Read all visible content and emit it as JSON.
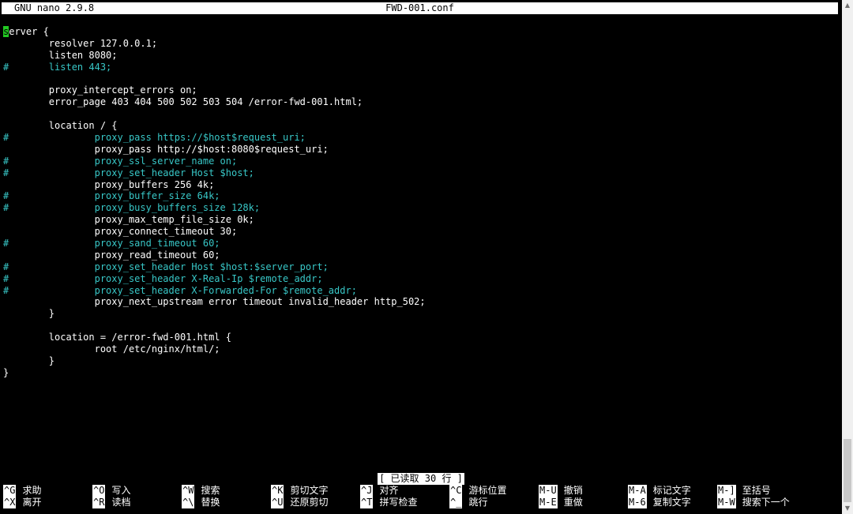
{
  "titlebar": {
    "program": "GNU nano 2.9.8",
    "filename": "FWD-001.conf"
  },
  "lines": [
    {
      "text": "server {",
      "comment": false
    },
    {
      "text": "        resolver 127.0.0.1;",
      "comment": false
    },
    {
      "text": "        listen 8080;",
      "comment": false
    },
    {
      "text": "#       listen 443;",
      "comment": true
    },
    {
      "text": "",
      "comment": false
    },
    {
      "text": "        proxy_intercept_errors on;",
      "comment": false
    },
    {
      "text": "        error_page 403 404 500 502 503 504 /error-fwd-001.html;",
      "comment": false
    },
    {
      "text": "",
      "comment": false
    },
    {
      "text": "        location / {",
      "comment": false
    },
    {
      "text": "#               proxy_pass https://$host$request_uri;",
      "comment": true
    },
    {
      "text": "                proxy_pass http://$host:8080$request_uri;",
      "comment": false
    },
    {
      "text": "#               proxy_ssl_server_name on;",
      "comment": true
    },
    {
      "text": "#               proxy_set_header Host $host;",
      "comment": true
    },
    {
      "text": "                proxy_buffers 256 4k;",
      "comment": false
    },
    {
      "text": "#               proxy_buffer_size 64k;",
      "comment": true
    },
    {
      "text": "#               proxy_busy_buffers_size 128k;",
      "comment": true
    },
    {
      "text": "                proxy_max_temp_file_size 0k;",
      "comment": false
    },
    {
      "text": "                proxy_connect_timeout 30;",
      "comment": false
    },
    {
      "text": "#               proxy_sand_timeout 60;",
      "comment": true
    },
    {
      "text": "                proxy_read_timeout 60;",
      "comment": false
    },
    {
      "text": "#               proxy_set_header Host $host:$server_port;",
      "comment": true
    },
    {
      "text": "#               proxy_set_header X-Real-Ip $remote_addr;",
      "comment": true
    },
    {
      "text": "#               proxy_set_header X-Forwarded-For $remote_addr;",
      "comment": true
    },
    {
      "text": "                proxy_next_upstream error timeout invalid_header http_502;",
      "comment": false
    },
    {
      "text": "        }",
      "comment": false
    },
    {
      "text": "",
      "comment": false
    },
    {
      "text": "        location = /error-fwd-001.html {",
      "comment": false
    },
    {
      "text": "                root /etc/nginx/html/;",
      "comment": false
    },
    {
      "text": "        }",
      "comment": false
    },
    {
      "text": "}",
      "comment": false
    }
  ],
  "status": "[ 已读取 30 行 ]",
  "shortcuts_row1": [
    {
      "key": "^G",
      "label": "求助"
    },
    {
      "key": "^O",
      "label": "写入"
    },
    {
      "key": "^W",
      "label": "搜索"
    },
    {
      "key": "^K",
      "label": "剪切文字"
    },
    {
      "key": "^J",
      "label": "对齐"
    },
    {
      "key": "^C",
      "label": "游标位置"
    },
    {
      "key": "M-U",
      "label": "撤销"
    },
    {
      "key": "M-A",
      "label": "标记文字"
    },
    {
      "key": "M-]",
      "label": "至括号"
    }
  ],
  "shortcuts_row2": [
    {
      "key": "^X",
      "label": "离开"
    },
    {
      "key": "^R",
      "label": "读档"
    },
    {
      "key": "^\\",
      "label": "替换"
    },
    {
      "key": "^U",
      "label": "还原剪切"
    },
    {
      "key": "^T",
      "label": "拼写检查"
    },
    {
      "key": "^_",
      "label": "跳行"
    },
    {
      "key": "M-E",
      "label": "重做"
    },
    {
      "key": "M-6",
      "label": "复制文字"
    },
    {
      "key": "M-W",
      "label": "搜索下一个"
    }
  ],
  "colors": {
    "background": "#000000",
    "foreground": "#ffffff",
    "comment": "#38c7c7",
    "cursor": "#22c922"
  },
  "icons": {
    "scroll_up": "triangle-up",
    "scroll_down": "triangle-down"
  }
}
